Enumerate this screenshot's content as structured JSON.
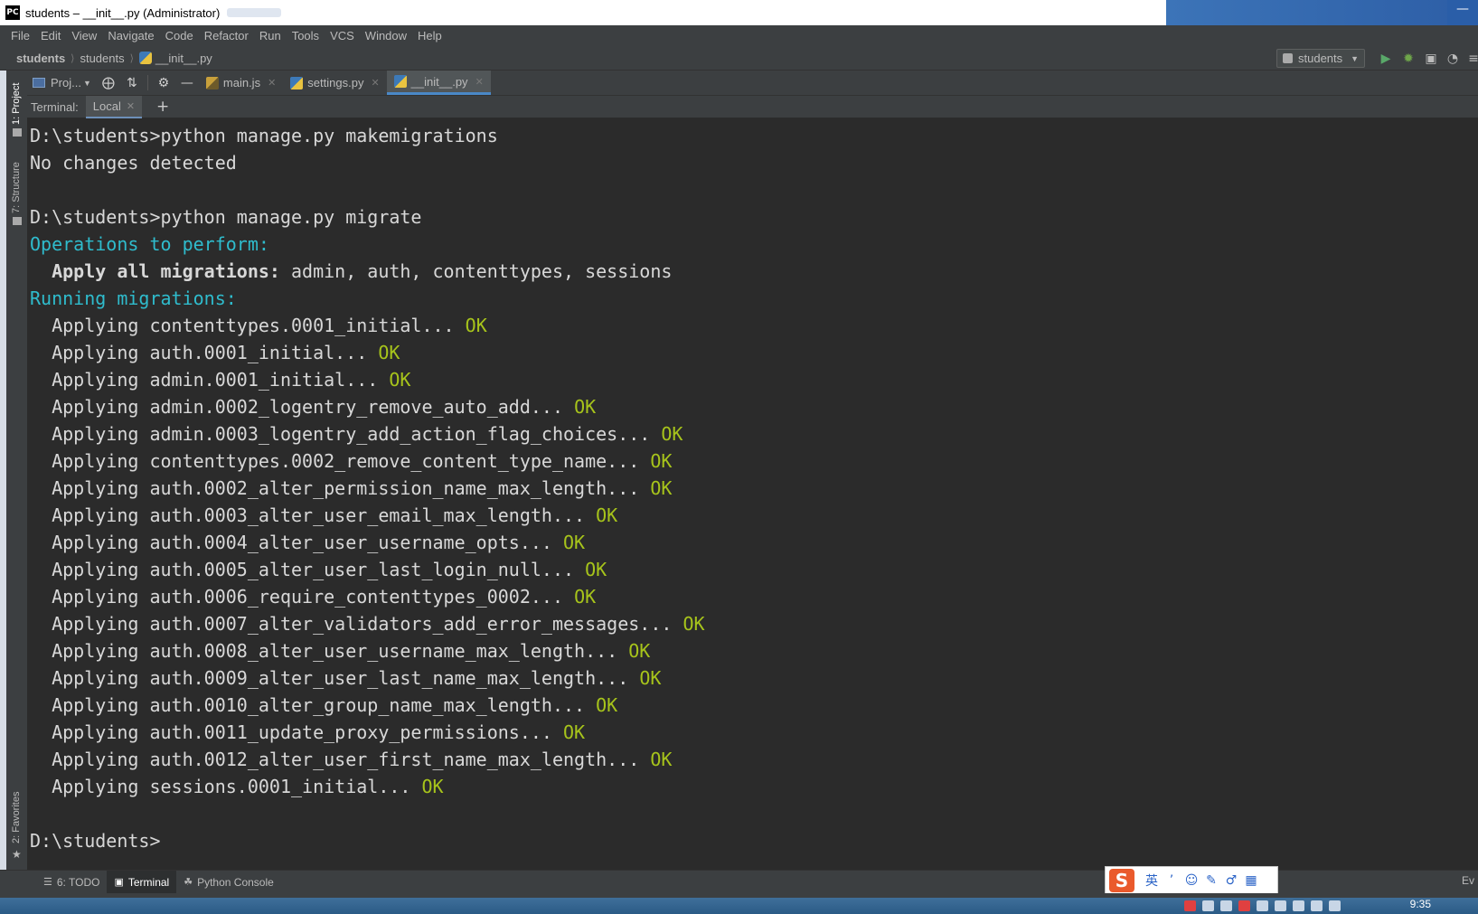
{
  "window": {
    "title": "students – __init__.py (Administrator)",
    "app_icon_text": "PC"
  },
  "menu": [
    "File",
    "Edit",
    "View",
    "Navigate",
    "Code",
    "Refactor",
    "Run",
    "Tools",
    "VCS",
    "Window",
    "Help"
  ],
  "breadcrumb": {
    "project": "students",
    "folder": "students",
    "file": "__init__.py"
  },
  "run_config": {
    "label": "students"
  },
  "left_strip": {
    "project": "1: Project",
    "structure": "7: Structure",
    "favorites": "2: Favorites"
  },
  "tabs": {
    "project_button": "Proj...",
    "files": [
      {
        "label": "main.js",
        "type": "js"
      },
      {
        "label": "settings.py",
        "type": "py"
      },
      {
        "label": "__init__.py",
        "type": "py",
        "active": true
      }
    ]
  },
  "terminal": {
    "label": "Terminal:",
    "session": "Local",
    "lines": [
      {
        "text": "D:\\students>python manage.py makemigrations"
      },
      {
        "text": "No changes detected"
      },
      {
        "text": ""
      },
      {
        "text": "D:\\students>python manage.py migrate"
      },
      {
        "text": "Operations to perform:",
        "style": "cyan"
      },
      {
        "text": "  Apply all migrations: ",
        "style": "bold",
        "rest": "admin, auth, contenttypes, sessions"
      },
      {
        "text": "Running migrations:",
        "style": "cyan"
      },
      {
        "text": "  Applying contenttypes.0001_initial...",
        "ok": "OK"
      },
      {
        "text": "  Applying auth.0001_initial...",
        "ok": "OK"
      },
      {
        "text": "  Applying admin.0001_initial...",
        "ok": "OK"
      },
      {
        "text": "  Applying admin.0002_logentry_remove_auto_add...",
        "ok": "OK"
      },
      {
        "text": "  Applying admin.0003_logentry_add_action_flag_choices...",
        "ok": "OK"
      },
      {
        "text": "  Applying contenttypes.0002_remove_content_type_name...",
        "ok": "OK"
      },
      {
        "text": "  Applying auth.0002_alter_permission_name_max_length...",
        "ok": "OK"
      },
      {
        "text": "  Applying auth.0003_alter_user_email_max_length...",
        "ok": "OK"
      },
      {
        "text": "  Applying auth.0004_alter_user_username_opts...",
        "ok": "OK"
      },
      {
        "text": "  Applying auth.0005_alter_user_last_login_null...",
        "ok": "OK"
      },
      {
        "text": "  Applying auth.0006_require_contenttypes_0002...",
        "ok": "OK"
      },
      {
        "text": "  Applying auth.0007_alter_validators_add_error_messages...",
        "ok": "OK"
      },
      {
        "text": "  Applying auth.0008_alter_user_username_max_length...",
        "ok": "OK"
      },
      {
        "text": "  Applying auth.0009_alter_user_last_name_max_length...",
        "ok": "OK"
      },
      {
        "text": "  Applying auth.0010_alter_group_name_max_length...",
        "ok": "OK"
      },
      {
        "text": "  Applying auth.0011_update_proxy_permissions...",
        "ok": "OK"
      },
      {
        "text": "  Applying auth.0012_alter_user_first_name_max_length...",
        "ok": "OK"
      },
      {
        "text": "  Applying sessions.0001_initial...",
        "ok": "OK"
      },
      {
        "text": ""
      },
      {
        "text": "D:\\students>"
      }
    ]
  },
  "bottom_tools": [
    {
      "label": "6: TODO",
      "icon": "list-icon"
    },
    {
      "label": "Terminal",
      "icon": "terminal-icon",
      "active": true
    },
    {
      "label": "Python Console",
      "icon": "python-icon"
    }
  ],
  "ime": {
    "logo": "S",
    "items": [
      "英",
      "’",
      "☺",
      "✎",
      "♂",
      "▦"
    ]
  },
  "event_log": "Ev",
  "taskbar": {
    "clock": "9:35"
  },
  "colors": {
    "terminal_bg": "#2b2b2b",
    "cyan": "#2fbccd",
    "ok": "#a7c41b",
    "chrome": "#3c3f41",
    "accent": "#4a88c7"
  }
}
